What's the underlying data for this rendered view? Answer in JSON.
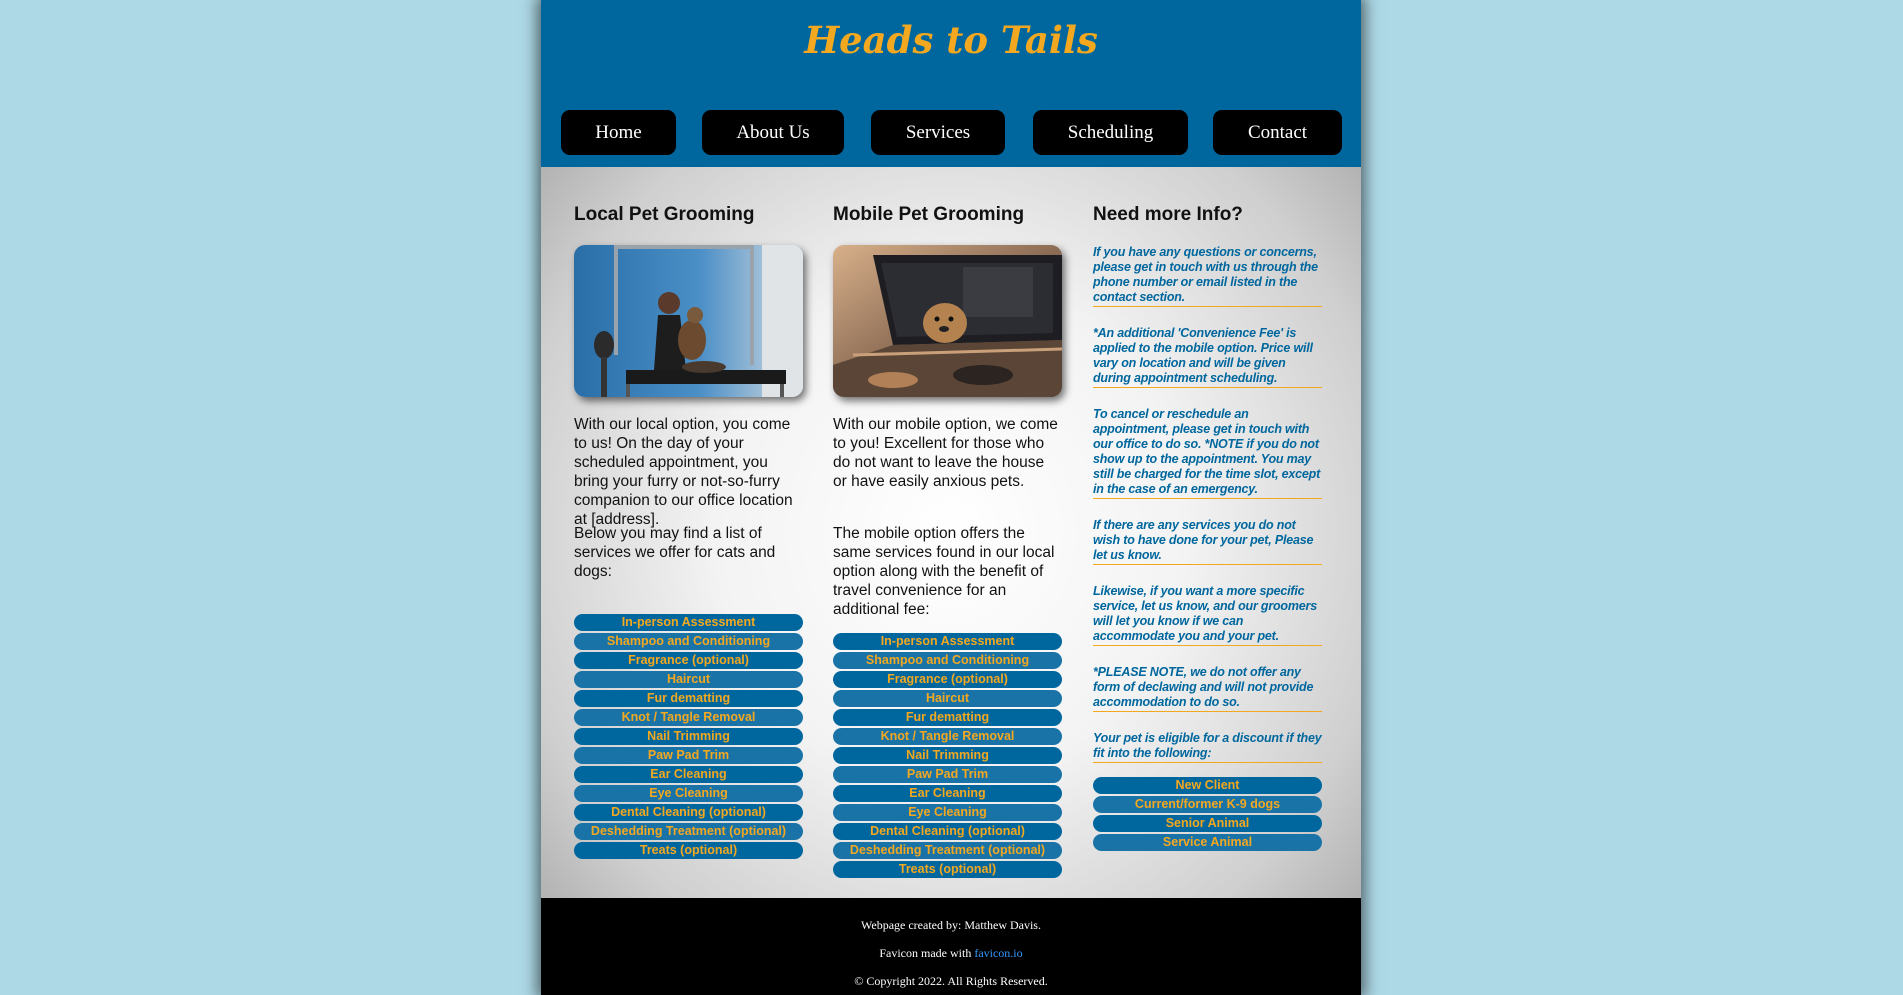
{
  "site": {
    "title": "Heads to Tails"
  },
  "nav": [
    {
      "label": "Home"
    },
    {
      "label": "About Us"
    },
    {
      "label": "Services"
    },
    {
      "label": "Scheduling"
    },
    {
      "label": "Contact"
    }
  ],
  "local": {
    "heading": "Local Pet Grooming",
    "paragraphs": [
      "With our local option, you come to us! On the day of your scheduled appointment, you bring your furry or not-so-furry companion to our office location at [address].",
      "Below you may find a list of services we offer for cats and dogs:"
    ],
    "services": [
      "In-person Assessment",
      "Shampoo and Conditioning",
      "Fragrance (optional)",
      "Haircut",
      "Fur dematting",
      "Knot / Tangle Removal",
      "Nail Trimming",
      "Paw Pad Trim",
      "Ear Cleaning",
      "Eye Cleaning",
      "Dental Cleaning (optional)",
      "Deshedding Treatment (optional)",
      "Treats (optional)"
    ]
  },
  "mobile": {
    "heading": "Mobile Pet Grooming",
    "paragraphs": [
      "With our mobile option, we come to you! Excellent for those who do not want to leave the house or have easily anxious pets.",
      "The mobile option offers the same services found in our local option along with the benefit of travel convenience for an additional fee:"
    ],
    "services": [
      "In-person Assessment",
      "Shampoo and Conditioning",
      "Fragrance (optional)",
      "Haircut",
      "Fur dematting",
      "Knot / Tangle Removal",
      "Nail Trimming",
      "Paw Pad Trim",
      "Ear Cleaning",
      "Eye Cleaning",
      "Dental Cleaning (optional)",
      "Deshedding Treatment (optional)",
      "Treats (optional)"
    ]
  },
  "info": {
    "heading": "Need more Info?",
    "notes": [
      "If you have any questions or concerns, please get in touch with us through the phone number or email listed in the contact section.",
      "*An additional 'Convenience Fee' is applied to the mobile option. Price will vary on location and will be given during appointment scheduling.",
      "To cancel or reschedule an appointment, please get in touch with our office to do so. *NOTE if you do not show up to the appointment. You may still be charged for the time slot, except in the case of an emergency.",
      "If there are any services you do not wish to have done for your pet, Please let us know.",
      "Likewise, if you want a more specific service, let us know, and our groomers will let you know if we can accommodate you and your pet.",
      "*PLEASE NOTE, we do not offer any form of declawing and will not provide accommodation to do so.",
      "Your pet is eligible for a discount if they fit into the following:"
    ],
    "discounts": [
      "New Client",
      "Current/former K-9 dogs",
      "Senior Animal",
      "Service Animal"
    ]
  },
  "footer": {
    "credit": "Webpage created by: Matthew Davis.",
    "favicon_prefix": "Favicon made with ",
    "favicon_link": "favicon.io",
    "copyright": "© Copyright 2022. All Rights Reserved."
  },
  "colors": {
    "header": "#00679e",
    "accent": "#f4a81f",
    "page_bg": "#add8e6",
    "footer": "#000000"
  }
}
